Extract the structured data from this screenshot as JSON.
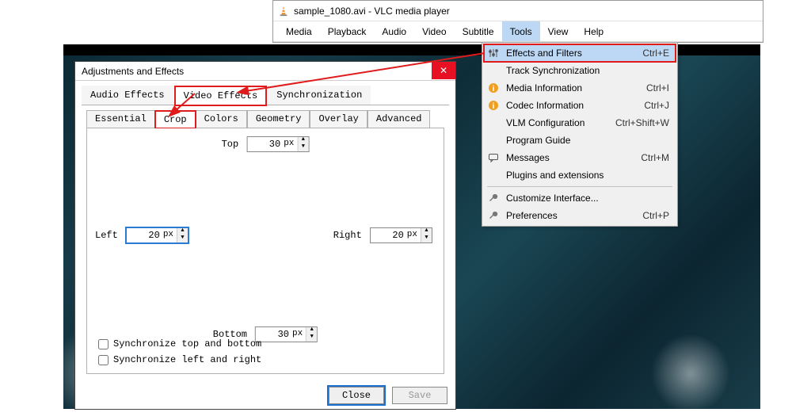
{
  "window": {
    "title": "sample_1080.avi - VLC media player"
  },
  "menubar": [
    "Media",
    "Playback",
    "Audio",
    "Video",
    "Subtitle",
    "Tools",
    "View",
    "Help"
  ],
  "tools_menu": [
    {
      "icon": "sliders",
      "label": "Effects and Filters",
      "shortcut": "Ctrl+E",
      "hl": true
    },
    {
      "icon": "",
      "label": "Track Synchronization",
      "shortcut": ""
    },
    {
      "icon": "info",
      "label": "Media Information",
      "shortcut": "Ctrl+I"
    },
    {
      "icon": "info",
      "label": "Codec Information",
      "shortcut": "Ctrl+J"
    },
    {
      "icon": "",
      "label": "VLM Configuration",
      "shortcut": "Ctrl+Shift+W"
    },
    {
      "icon": "",
      "label": "Program Guide",
      "shortcut": ""
    },
    {
      "icon": "chat",
      "label": "Messages",
      "shortcut": "Ctrl+M"
    },
    {
      "icon": "",
      "label": "Plugins and extensions",
      "shortcut": ""
    },
    {
      "sep": true
    },
    {
      "icon": "wrench",
      "label": "Customize Interface...",
      "shortcut": ""
    },
    {
      "icon": "wrench",
      "label": "Preferences",
      "shortcut": "Ctrl+P"
    }
  ],
  "dialog": {
    "title": "Adjustments and Effects",
    "top_tabs": [
      "Audio Effects",
      "Video Effects",
      "Synchronization"
    ],
    "sub_tabs": [
      "Essential",
      "Crop",
      "Colors",
      "Geometry",
      "Overlay",
      "Advanced"
    ],
    "crop": {
      "top_label": "Top",
      "top_value": "30",
      "top_unit": "px",
      "left_label": "Left",
      "left_value": "20",
      "left_unit": "px",
      "right_label": "Right",
      "right_value": "20",
      "right_unit": "px",
      "bottom_label": "Bottom",
      "bottom_value": "30",
      "bottom_unit": "px",
      "sync_tb": "Synchronize top and bottom",
      "sync_lr": "Synchronize left and right"
    },
    "buttons": {
      "close": "Close",
      "save": "Save"
    }
  }
}
